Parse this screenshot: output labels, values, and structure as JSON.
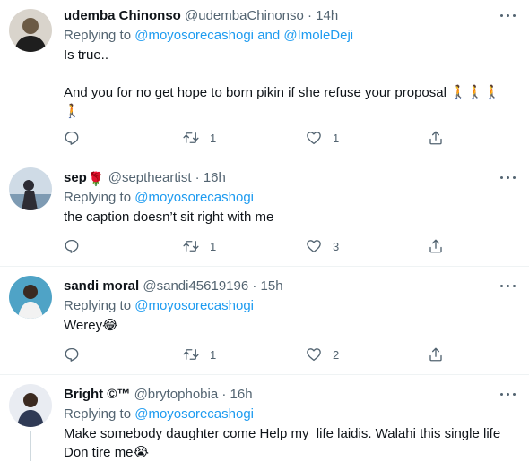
{
  "tweets": [
    {
      "name": "udemba Chinonso",
      "name_emoji": "",
      "handle": "@udembaChinonso",
      "dot": "·",
      "time": "14h",
      "reply_prefix": "Replying to",
      "reply_to": "@moyosorecashogi",
      "reply_and": "and",
      "reply_to_2": "@ImoleDeji",
      "text": "Is true..\n\nAnd you for no get hope to born pikin if she refuse your proposal 🚶🚶🚶\n🚶",
      "replies": "",
      "retweets": "1",
      "likes": "1",
      "avatar_color": "#6b5a45"
    },
    {
      "name": "sep",
      "name_emoji": "🌹",
      "handle": "@septheartist",
      "dot": "·",
      "time": "16h",
      "reply_prefix": "Replying to",
      "reply_to": "@moyosorecashogi",
      "text": "the caption doesn’t sit right with me",
      "replies": "",
      "retweets": "1",
      "likes": "3",
      "avatar_color": "#7e9bb3"
    },
    {
      "name": "sandi moral",
      "name_emoji": "",
      "handle": "@sandi45619196",
      "dot": "·",
      "time": "15h",
      "reply_prefix": "Replying to",
      "reply_to": "@moyosorecashogi",
      "text": "Werey😂",
      "replies": "",
      "retweets": "1",
      "likes": "2",
      "avatar_color": "#4fa3c6"
    },
    {
      "name": "Bright ©™",
      "name_emoji": "",
      "handle": "@brytophobia",
      "dot": "·",
      "time": "16h",
      "reply_prefix": "Replying to",
      "reply_to": "@moyosorecashogi",
      "text": "Make somebody daughter come Help my  life laidis. Walahi this single life\nDon tire me😭",
      "avatar_color": "#2f3a55"
    }
  ],
  "icons": {
    "reply": "reply-icon",
    "retweet": "retweet-icon",
    "like": "heart-icon",
    "share": "share-icon",
    "more": "more-icon"
  },
  "colors": {
    "text": "#0f1419",
    "secondary": "#536471",
    "link": "#1d9bf0",
    "divider": "#eff3f4"
  }
}
